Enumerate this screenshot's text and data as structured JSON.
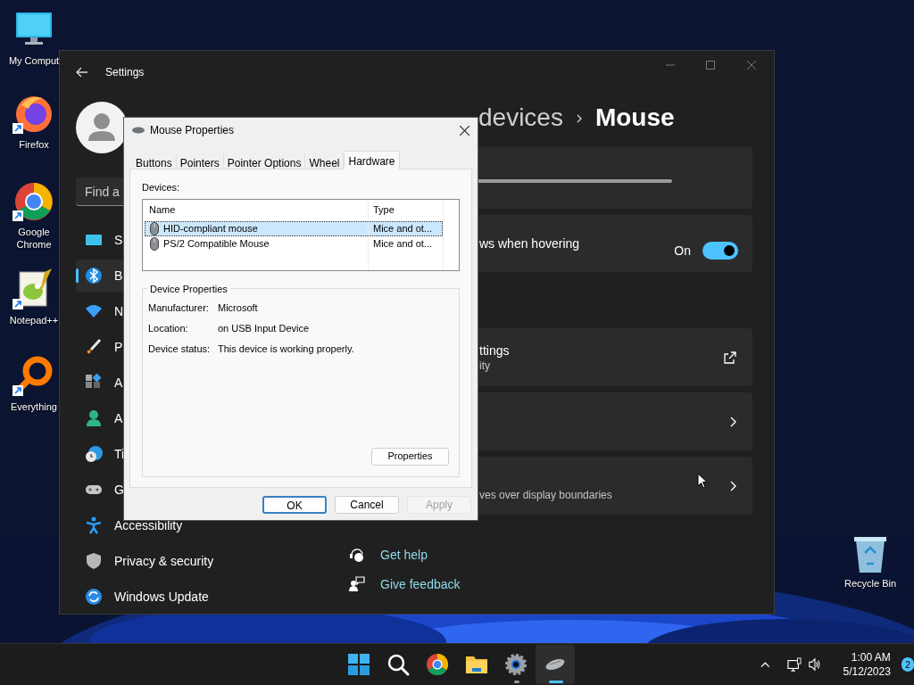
{
  "desktop_icons": [
    {
      "label": "My Comput",
      "kind": "computer",
      "shortcut": false
    },
    {
      "label": "Firefox",
      "kind": "firefox",
      "shortcut": true
    },
    {
      "label": "Google Chrome",
      "kind": "chrome",
      "shortcut": true
    },
    {
      "label": "Notepad++",
      "kind": "notepad",
      "shortcut": true
    },
    {
      "label": "Everything",
      "kind": "everything",
      "shortcut": true
    },
    {
      "label": "Recycle Bin",
      "kind": "recycle",
      "shortcut": false
    }
  ],
  "settings_window": {
    "title": "Settings",
    "search": {
      "placeholder": "Find a"
    },
    "nav_items": [
      {
        "label": "S",
        "kind": "system",
        "selected": false
      },
      {
        "label": "B",
        "kind": "bluetooth",
        "selected": true
      },
      {
        "label": "N",
        "kind": "network",
        "selected": false
      },
      {
        "label": "P",
        "kind": "personalization",
        "selected": false
      },
      {
        "label": "A",
        "kind": "apps",
        "selected": false
      },
      {
        "label": "A",
        "kind": "accounts",
        "selected": false
      },
      {
        "label": "Ti",
        "kind": "time",
        "selected": false
      },
      {
        "label": "G",
        "kind": "gaming",
        "selected": false
      },
      {
        "label": "Accessibility",
        "kind": "accessibility",
        "selected": false
      },
      {
        "label": "Privacy & security",
        "kind": "privacy",
        "selected": false
      },
      {
        "label": "Windows Update",
        "kind": "update",
        "selected": false
      }
    ],
    "breadcrumb": {
      "parent": "devices",
      "current": "Mouse"
    },
    "cards": [
      {
        "kind": "slider"
      },
      {
        "kind": "toggle",
        "title": "ws when hovering",
        "state_label": "On",
        "on": true
      },
      {
        "kind": "external",
        "title": "ttings",
        "subtitle": "ity"
      },
      {
        "kind": "chevron"
      },
      {
        "kind": "chevron",
        "subtitle": "ves over display boundaries"
      }
    ],
    "help_links": [
      {
        "label": "Get help",
        "kind": "help"
      },
      {
        "label": "Give feedback",
        "kind": "feedback"
      }
    ]
  },
  "dialog": {
    "title": "Mouse Properties",
    "tabs": [
      {
        "label": "Buttons",
        "selected": false
      },
      {
        "label": "Pointers",
        "selected": false
      },
      {
        "label": "Pointer Options",
        "selected": false
      },
      {
        "label": "Wheel",
        "selected": false
      },
      {
        "label": "Hardware",
        "selected": true
      }
    ],
    "devices_label": "Devices:",
    "columns": [
      "Name",
      "Type"
    ],
    "devices": [
      {
        "name": "HID-compliant mouse",
        "type": "Mice and ot...",
        "selected": true
      },
      {
        "name": "PS/2 Compatible Mouse",
        "type": "Mice and ot...",
        "selected": false
      }
    ],
    "group_title": "Device Properties",
    "properties": [
      {
        "label": "Manufacturer:",
        "value": "Microsoft"
      },
      {
        "label": "Location:",
        "value": "on USB Input Device"
      },
      {
        "label": "Device status:",
        "value": "This device is working properly."
      }
    ],
    "properties_button": "Properties",
    "buttons": [
      {
        "label": "OK",
        "default": true,
        "disabled": false
      },
      {
        "label": "Cancel",
        "default": false,
        "disabled": false
      },
      {
        "label": "Apply",
        "default": false,
        "disabled": true
      }
    ]
  },
  "taskbar": {
    "apps": [
      {
        "kind": "start",
        "running": false,
        "selected": false
      },
      {
        "kind": "search",
        "running": false,
        "selected": false
      },
      {
        "kind": "chrome",
        "running": false,
        "selected": false
      },
      {
        "kind": "explorer",
        "running": false,
        "selected": false
      },
      {
        "kind": "settings",
        "running": true,
        "selected": false
      },
      {
        "kind": "mouse",
        "running": true,
        "selected": true
      }
    ],
    "time": "1:00 AM",
    "date": "5/12/2023",
    "notification_count": "2"
  }
}
